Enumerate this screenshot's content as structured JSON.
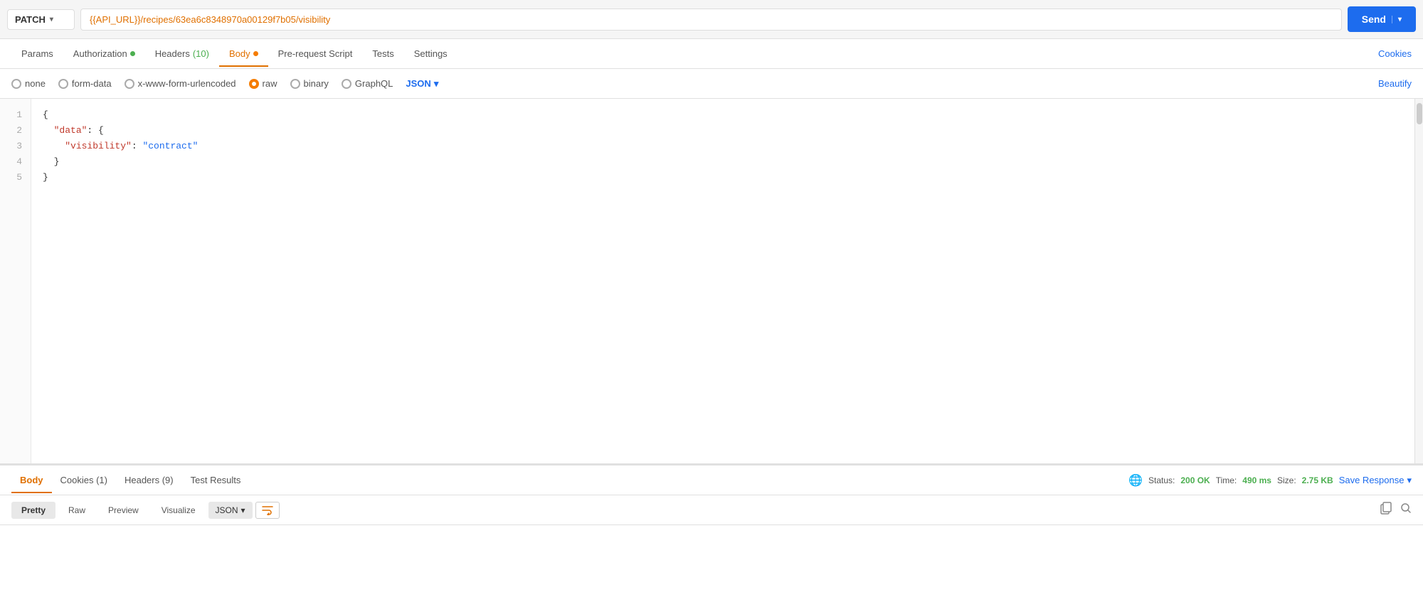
{
  "method": {
    "value": "PATCH",
    "chevron": "▾"
  },
  "url": {
    "value": "{{API_URL}}/recipes/63ea6c8348970a00129f7b05/visibility"
  },
  "send_button": {
    "label": "Send",
    "chevron": "▾"
  },
  "tabs": {
    "params": {
      "label": "Params"
    },
    "authorization": {
      "label": "Authorization",
      "dot": true,
      "dot_color": "green"
    },
    "headers": {
      "label": "Headers",
      "count": "(10)",
      "count_color": "green"
    },
    "body": {
      "label": "Body",
      "dot": true,
      "dot_color": "orange",
      "active": true
    },
    "prerequest": {
      "label": "Pre-request Script"
    },
    "tests": {
      "label": "Tests"
    },
    "settings": {
      "label": "Settings"
    },
    "cookies": {
      "label": "Cookies"
    }
  },
  "body_options": {
    "none": {
      "label": "none",
      "checked": false
    },
    "form_data": {
      "label": "form-data",
      "checked": false
    },
    "urlencoded": {
      "label": "x-www-form-urlencoded",
      "checked": false
    },
    "raw": {
      "label": "raw",
      "checked": true
    },
    "binary": {
      "label": "binary",
      "checked": false
    },
    "graphql": {
      "label": "GraphQL",
      "checked": false
    },
    "json": {
      "label": "JSON",
      "chevron": "▾"
    },
    "beautify": {
      "label": "Beautify"
    }
  },
  "code": {
    "lines": [
      {
        "num": "1",
        "content": "{"
      },
      {
        "num": "2",
        "content": "  \"data\": {"
      },
      {
        "num": "3",
        "content": "    \"visibility\": \"contract\""
      },
      {
        "num": "4",
        "content": "  }"
      },
      {
        "num": "5",
        "content": "}"
      }
    ]
  },
  "response": {
    "tabs": {
      "body": {
        "label": "Body",
        "active": true
      },
      "cookies": {
        "label": "Cookies (1)"
      },
      "headers": {
        "label": "Headers (9)"
      },
      "test_results": {
        "label": "Test Results"
      }
    },
    "status": {
      "label": "Status:",
      "code": "200 OK",
      "time_label": "Time:",
      "time_value": "490 ms",
      "size_label": "Size:",
      "size_value": "2.75 KB"
    },
    "save_response": {
      "label": "Save Response",
      "chevron": "▾"
    },
    "format": {
      "pretty": {
        "label": "Pretty",
        "active": true
      },
      "raw": {
        "label": "Raw"
      },
      "preview": {
        "label": "Preview"
      },
      "visualize": {
        "label": "Visualize"
      },
      "json": {
        "label": "JSON",
        "chevron": "▾"
      }
    }
  }
}
